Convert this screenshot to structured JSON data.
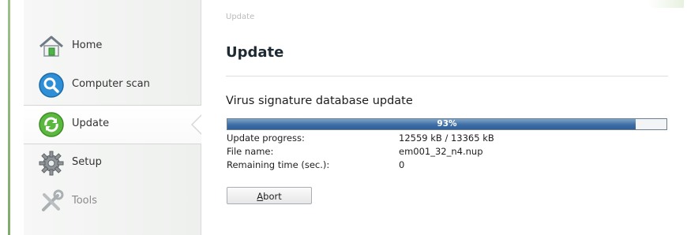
{
  "sidebar": {
    "items": [
      {
        "label": "Home",
        "icon": "home-icon"
      },
      {
        "label": "Computer scan",
        "icon": "magnifier-icon"
      },
      {
        "label": "Update",
        "icon": "update-arrows-icon",
        "active": true
      },
      {
        "label": "Setup",
        "icon": "gear-icon"
      },
      {
        "label": "Tools",
        "icon": "tools-icon"
      }
    ]
  },
  "main": {
    "breadcrumb": "Update",
    "title": "Update",
    "section_title": "Virus signature database update",
    "progress": {
      "percent_label": "93%",
      "value": 0.93
    },
    "info": [
      {
        "key": "Update progress:",
        "value": "12559 kB / 13365 kB"
      },
      {
        "key": "File name:",
        "value": "em001_32_n4.nup"
      },
      {
        "key": "Remaining time (sec.):",
        "value": "0"
      }
    ],
    "abort_button": {
      "accel": "A",
      "rest": "bort"
    }
  },
  "colors": {
    "accent": "#3e6ea5",
    "sidebar_strip": "#9cc08a"
  }
}
